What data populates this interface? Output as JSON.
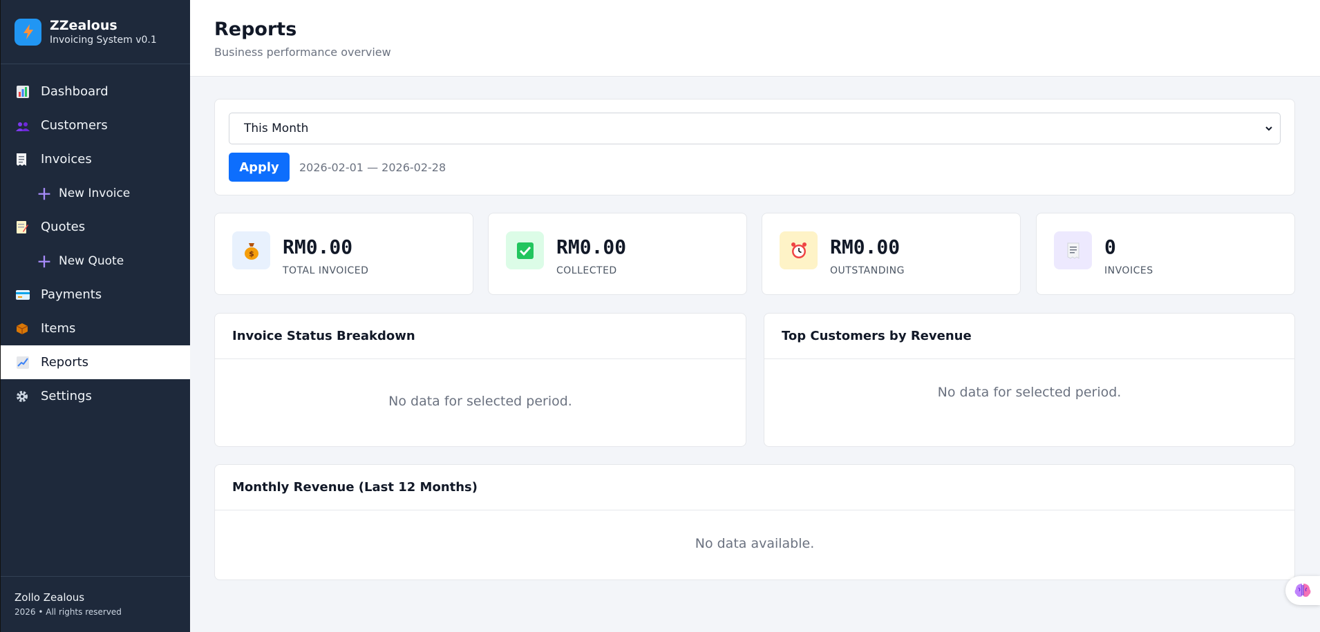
{
  "app": {
    "name": "ZZealous",
    "version_label": "Invoicing System v0.1"
  },
  "sidebar": {
    "items": [
      {
        "label": "Dashboard",
        "icon": "bar-chart-icon"
      },
      {
        "label": "Customers",
        "icon": "users-icon"
      },
      {
        "label": "Invoices",
        "icon": "receipt-icon"
      },
      {
        "label": "New Invoice",
        "icon": "plus-icon",
        "sub": true
      },
      {
        "label": "Quotes",
        "icon": "memo-icon"
      },
      {
        "label": "New Quote",
        "icon": "plus-icon",
        "sub": true
      },
      {
        "label": "Payments",
        "icon": "credit-card-icon"
      },
      {
        "label": "Items",
        "icon": "package-icon"
      },
      {
        "label": "Reports",
        "icon": "line-chart-icon",
        "active": true
      },
      {
        "label": "Settings",
        "icon": "gear-icon"
      }
    ],
    "footer": {
      "name": "Zollo Zealous",
      "copyright": "2026 • All rights reserved"
    }
  },
  "header": {
    "title": "Reports",
    "subtitle": "Business performance overview"
  },
  "filter": {
    "period_selected": "This Month",
    "apply_label": "Apply",
    "date_range": "2026-02-01 — 2026-02-28"
  },
  "stats": [
    {
      "value": "RM0.00",
      "label": "TOTAL INVOICED",
      "icon": "money-bag-icon",
      "bg": "#e8f1fd"
    },
    {
      "value": "RM0.00",
      "label": "COLLECTED",
      "icon": "check-box-icon",
      "bg": "#dcfce7"
    },
    {
      "value": "RM0.00",
      "label": "OUTSTANDING",
      "icon": "alarm-clock-icon",
      "bg": "#fef3c7"
    },
    {
      "value": "0",
      "label": "INVOICES",
      "icon": "receipt-icon",
      "bg": "#ede9fe"
    }
  ],
  "panels": {
    "status_breakdown": {
      "title": "Invoice Status Breakdown",
      "empty": "No data for selected period."
    },
    "top_customers": {
      "title": "Top Customers by Revenue",
      "empty": "No data for selected period."
    },
    "monthly_revenue": {
      "title": "Monthly Revenue (Last 12 Months)",
      "empty": "No data available."
    }
  },
  "colors": {
    "sidebar_bg": "#1e293b",
    "accent": "#0d6efd",
    "brand_logo": "#2196f3"
  }
}
